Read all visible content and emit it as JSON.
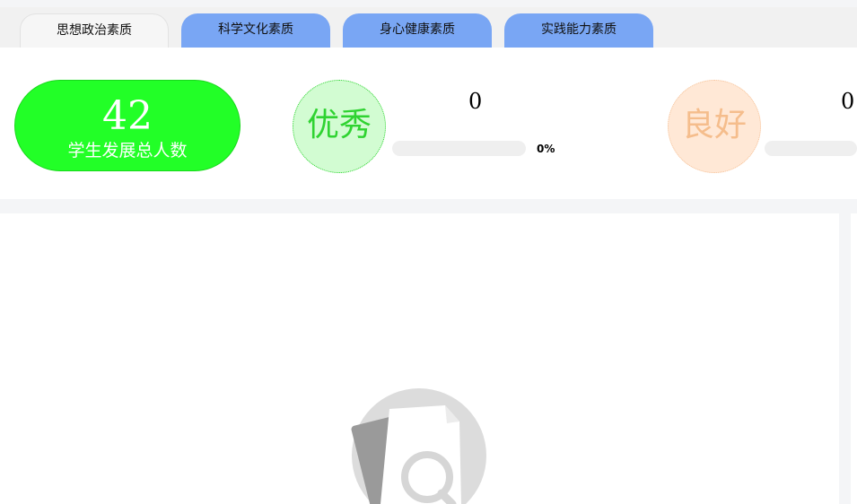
{
  "tabs": [
    {
      "label": "思想政治素质",
      "active": true
    },
    {
      "label": "科学文化素质",
      "active": false
    },
    {
      "label": "身心健康素质",
      "active": false
    },
    {
      "label": "实践能力素质",
      "active": false
    }
  ],
  "summary": {
    "total": "42",
    "total_label": "学生发展总人数"
  },
  "levels": {
    "excellent": {
      "label": "优秀",
      "count": "0",
      "percent_text": "0%",
      "fraction": 0
    },
    "good": {
      "label": "良好",
      "count": "0",
      "fraction": 0
    }
  },
  "colors": {
    "tab_active_bg": "#f6f6f6",
    "tab_inactive_bg": "#79a6f4",
    "total_bg": "#22ff27",
    "excellent_bg": "#d2fcd2",
    "excellent_text": "#2fd331",
    "good_bg": "#ffe8d6",
    "good_text": "#f5bd8c"
  },
  "icons": {
    "empty_state": "empty-document-search-icon"
  }
}
